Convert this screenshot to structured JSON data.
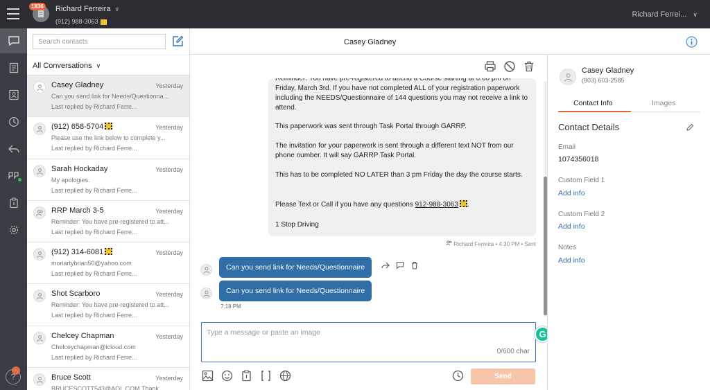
{
  "account": {
    "badge": "1836",
    "name": "Richard Ferreira",
    "phone": "(912) 988-3063"
  },
  "user_menu": "Richard Ferrei...",
  "contacts": {
    "search_placeholder": "Search contacts",
    "filter_label": "All Conversations",
    "items": [
      {
        "name": "Casey Gladney",
        "time": "Yesterday",
        "preview": "Can you send link for Needs/Questionna...",
        "replied": "Last replied by Richard Ferre...",
        "qr": false
      },
      {
        "name": "(912) 658-5704",
        "time": "Yesterday",
        "preview": "Please use the link below to complete y...",
        "replied": "Last replied by Richard Ferre...",
        "qr": true
      },
      {
        "name": "Sarah Hockaday",
        "time": "Yesterday",
        "preview": "My apologies.",
        "replied": "Last replied by Richard Ferre...",
        "qr": false
      },
      {
        "name": "RRP March 3-5",
        "time": "Yesterday",
        "preview": "Reminder: You have pre-registered to att...",
        "replied": "Last replied by Richard Ferre...",
        "qr": false
      },
      {
        "name": "(912) 314-6081",
        "time": "Yesterday",
        "preview": "moriartybrian50@yahoo.com",
        "replied": "Last replied by Richard Ferre...",
        "qr": true
      },
      {
        "name": "Shot Scarboro",
        "time": "Yesterday",
        "preview": "Reminder: You have pre-registered to att...",
        "replied": "Last replied by Richard Ferre...",
        "qr": false
      },
      {
        "name": "Chelcey Chapman",
        "time": "Yesterday",
        "preview": "Chelceychapman@icloud.com",
        "replied": "Last replied by Richard Ferre...",
        "qr": false
      },
      {
        "name": "Bruce Scott",
        "time": "Yesterday",
        "preview": "BRUCESCOTT543@AOL.COM Thank",
        "replied": "",
        "qr": false
      }
    ]
  },
  "thread": {
    "title": "Casey Gladney",
    "incoming": {
      "p1": "Reminder: You have pre-registered to attend a Course starting at 6:00 pm on Friday, March 3rd. If you have not completed ALL of your registration paperwork including the NEEDS/Questionnaire of 144 questions you may not receive a link to attend.",
      "p2": "This paperwork was sent through Task Portal through GARRP.",
      "p3": "The invitation for your paperwork is sent through a different text NOT from our phone number. It will say GARRP Task Portal.",
      "p4": "This has to be completed NO LATER than 3 pm Friday the day the course starts.",
      "p5_text": "Please Text or Call if you have any questions ",
      "p5_phone": "912-988-3063",
      "p5_end": ".",
      "p6": "1 Stop Driving",
      "meta": "Richard Ferreira • 4:30 PM • Sent"
    },
    "outgoing": [
      {
        "text": "Can you send link for Needs/Questionnaire"
      },
      {
        "text": "Can you send link for Needs/Questionnaire"
      }
    ],
    "out_time": "7:18 PM"
  },
  "composer": {
    "placeholder": "Type a message or paste an image",
    "char_count": "0/600 char",
    "send_label": "Send",
    "grammarly": "G"
  },
  "contact_panel": {
    "name": "Casey Gladney",
    "phone": "(803) 603-2585",
    "tabs": [
      "Contact Info",
      "Images"
    ],
    "section_title": "Contact Details",
    "email_label": "Email",
    "email_value": "1074356018",
    "cf1_label": "Custom Field 1",
    "cf1_link": "Add info",
    "cf2_label": "Custom Field 2",
    "cf2_link": "Add info",
    "notes_label": "Notes",
    "notes_link": "Add info"
  },
  "help_glyph": "?",
  "colors": {
    "topbar": "#2b2d33",
    "accent_blue": "#2f6ea7",
    "accent_orange": "#e8663d",
    "send_disabled": "#f7c5aa"
  }
}
